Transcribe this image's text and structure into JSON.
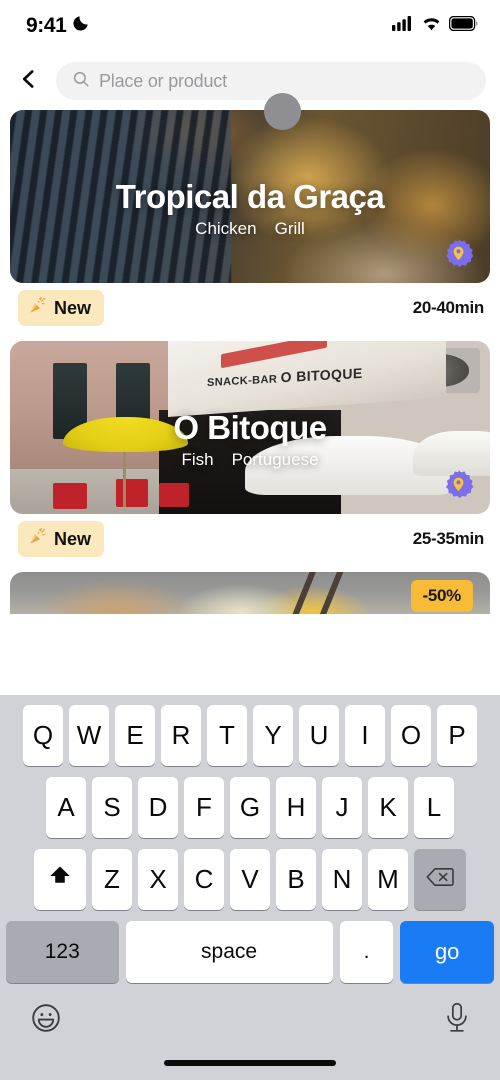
{
  "status_bar": {
    "time": "9:41",
    "moon_icon": "moon-icon",
    "signal_icon": "cellular-signal-icon",
    "wifi_icon": "wifi-icon",
    "battery_icon": "battery-full-icon"
  },
  "header": {
    "back_icon": "chevron-left-icon",
    "search": {
      "icon": "search-icon",
      "value": "",
      "placeholder": "Place or product"
    }
  },
  "colors": {
    "accent_blue": "#1a7cf5",
    "badge_amber": "#f7bb38",
    "new_badge_bg": "#fbe9bd",
    "keyboard_bg": "#d1d2d7",
    "pin_badge_purple": "#7b6ee8",
    "pin_badge_glyph": "#f6c43c"
  },
  "results": [
    {
      "name": "Tropical da Graça",
      "tags": [
        "Chicken",
        "Grill"
      ],
      "badge_label": "New",
      "badge_icon": "party-popper-icon",
      "eta": "20-40min",
      "pin_icon": "location-pin-badge-icon"
    },
    {
      "name": "O Bitoque",
      "sign_prefix": "SNACK-BAR ",
      "sign_name": "O BITOQUE",
      "tags": [
        "Fish",
        "Portuguese"
      ],
      "badge_label": "New",
      "badge_icon": "party-popper-icon",
      "eta": "25-35min",
      "pin_icon": "location-pin-badge-icon"
    },
    {
      "name": "",
      "discount_label": "-50%"
    }
  ],
  "keyboard": {
    "row1": [
      "Q",
      "W",
      "E",
      "R",
      "T",
      "Y",
      "U",
      "I",
      "O",
      "P"
    ],
    "row2": [
      "A",
      "S",
      "D",
      "F",
      "G",
      "H",
      "J",
      "K",
      "L"
    ],
    "row3": [
      "Z",
      "X",
      "C",
      "V",
      "B",
      "N",
      "M"
    ],
    "shift_icon": "shift-arrow-icon",
    "backspace_icon": "backspace-icon",
    "numbers_label": "123",
    "space_label": "space",
    "period_label": ".",
    "return_label": "go",
    "emoji_icon": "emoji-smiley-icon",
    "mic_icon": "microphone-icon"
  }
}
